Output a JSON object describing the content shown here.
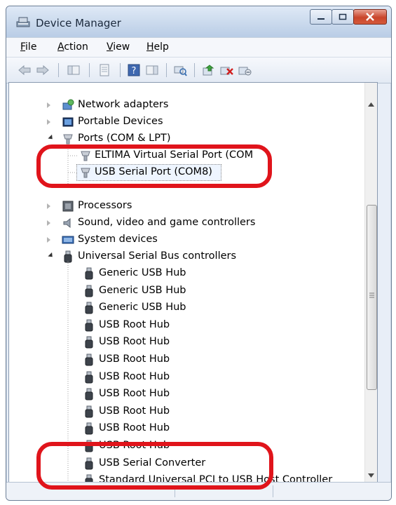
{
  "window": {
    "title": "Device Manager"
  },
  "menu": [
    {
      "label": "File",
      "mnemonic": "F",
      "rest": "ile"
    },
    {
      "label": "Action",
      "mnemonic": "A",
      "rest": "ction"
    },
    {
      "label": "View",
      "mnemonic": "V",
      "rest": "iew"
    },
    {
      "label": "Help",
      "mnemonic": "H",
      "rest": "elp"
    }
  ],
  "toolbar": {
    "buttons": [
      "back-icon",
      "forward-icon",
      "show-hide-console-tree-icon",
      "properties-icon",
      "help-icon",
      "show-action-pane-icon",
      "scan-hardware-icon",
      "update-driver-icon",
      "uninstall-icon",
      "disable-icon"
    ]
  },
  "tree": {
    "network_adapters": "Network adapters",
    "portable_devices": "Portable Devices",
    "ports": "Ports (COM & LPT)",
    "port_eltima": "ELTIMA Virtual Serial Port (COM",
    "port_usb_serial": "USB Serial Port (COM8)",
    "processors": "Processors",
    "sound": "Sound, video and game controllers",
    "system_devices": "System devices",
    "usb_controllers": "Universal Serial Bus controllers",
    "usb_items": [
      "Generic USB Hub",
      "Generic USB Hub",
      "Generic USB Hub",
      "USB Root Hub",
      "USB Root Hub",
      "USB Root Hub",
      "USB Root Hub",
      "USB Root Hub",
      "USB Root Hub",
      "USB Root Hub",
      "USB Root Hub",
      "USB Serial Converter",
      "Standard Universal PCI to USB Host Controller"
    ]
  },
  "colors": {
    "annotation": "#e0141b",
    "title_bg": "#c8d8ec",
    "close_button": "#c9452b"
  }
}
